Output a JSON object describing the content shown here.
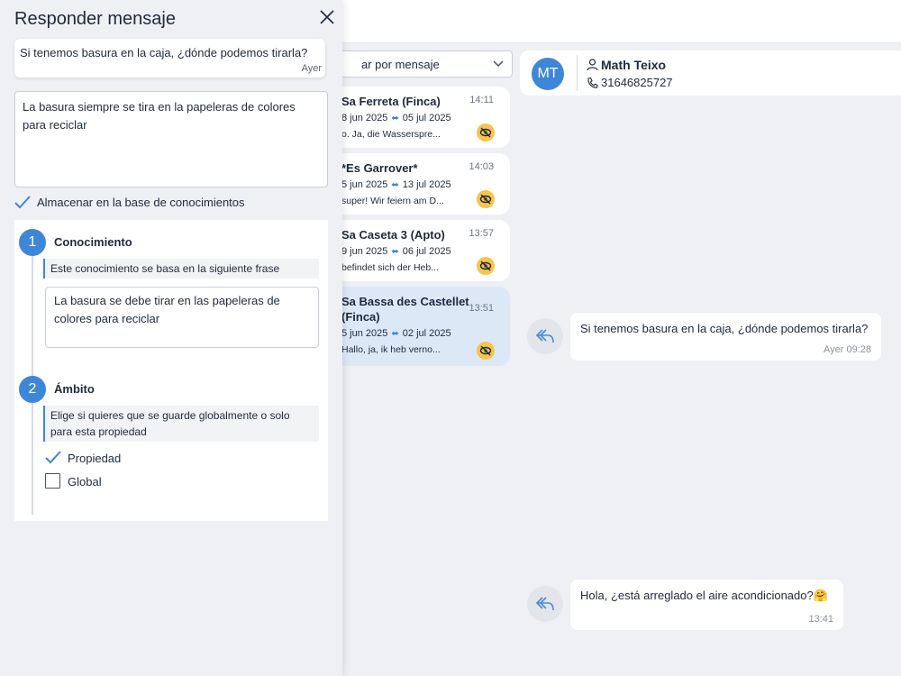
{
  "modal": {
    "title": "Responder mensaje",
    "original_message": {
      "text": "Si tenemos basura en la caja, ¿dónde podemos tirarla?",
      "time": "Ayer"
    },
    "answer_text": "La basura siempre se tira en la papeleras de colores para reciclar",
    "store_label": "Almacenar en la base de conocimientos",
    "steps": [
      {
        "number": "1",
        "title": "Conocimiento",
        "description": "Este conocimiento se basa en la siguiente frase",
        "knowledge_text": "La basura se debe tirar en las papeleras de colores para reciclar"
      },
      {
        "number": "2",
        "title": "Ámbito",
        "description": "Elige si quieres que se guarde globalmente o solo para esta propiedad",
        "options": [
          {
            "label": "Propiedad",
            "checked": true
          },
          {
            "label": "Global",
            "checked": false
          }
        ]
      }
    ]
  },
  "search": {
    "placeholder": "ar por mensaje"
  },
  "conversations": [
    {
      "name": "Sa Ferreta (Finca)",
      "time": "14:11",
      "from": "8 jun 2025",
      "to": "05 jul 2025",
      "preview": "o. Ja, die Wasserspre...",
      "active": false
    },
    {
      "name": "*Es Garrover*",
      "time": "14:03",
      "from": "5 jun 2025",
      "to": "13 jul 2025",
      "preview": "super! Wir feiern am D...",
      "active": false
    },
    {
      "name": "Sa Caseta 3 (Apto)",
      "time": "13:57",
      "from": "9 jun 2025",
      "to": "06 jul 2025",
      "preview": "befindet sich der Heb...",
      "active": false
    },
    {
      "name": "Sa Bassa des Castellet (Finca)",
      "time": "13:51",
      "from": "5 jun 2025",
      "to": "02 jul 2025",
      "preview": "Hallo, ja, ik heb verno...",
      "active": true
    }
  ],
  "contact": {
    "initials": "MT",
    "name": "Math Teixo",
    "phone": "31646825727"
  },
  "messages": [
    {
      "text": "Si tenemos basura en la caja, ¿dónde podemos tirarla?",
      "time": "Ayer 09:28"
    },
    {
      "text": "Hola, ¿está arreglado el aire acondicionado?🤗",
      "time": "13:41"
    }
  ],
  "colors": {
    "accent": "#3e86d8",
    "badge": "#f6c54a",
    "active_conversation": "#dde8f7"
  }
}
